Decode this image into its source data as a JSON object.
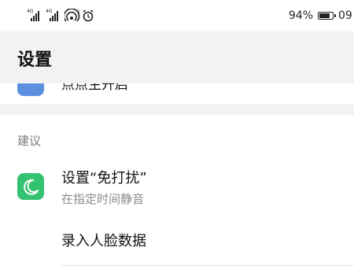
{
  "status_bar": {
    "network_1": "4G",
    "network_2": "4G",
    "battery": "94%",
    "battery_level": 0.94,
    "time": "09"
  },
  "header": {
    "title": "设置"
  },
  "partial_item": {
    "label": "点点生开启",
    "icon": "blue-app-icon"
  },
  "suggestions": {
    "section_label": "建议",
    "items": [
      {
        "title": "设置“免打扰”",
        "subtitle": "在指定时间静音",
        "icon": "moon-icon",
        "icon_color": "#33c270"
      },
      {
        "title": "录入人脸数据",
        "subtitle": ""
      }
    ]
  },
  "colors": {
    "background": "#f2f2f2",
    "card": "#ffffff",
    "accent_green": "#33c270",
    "accent_blue": "#5b8fe0"
  }
}
